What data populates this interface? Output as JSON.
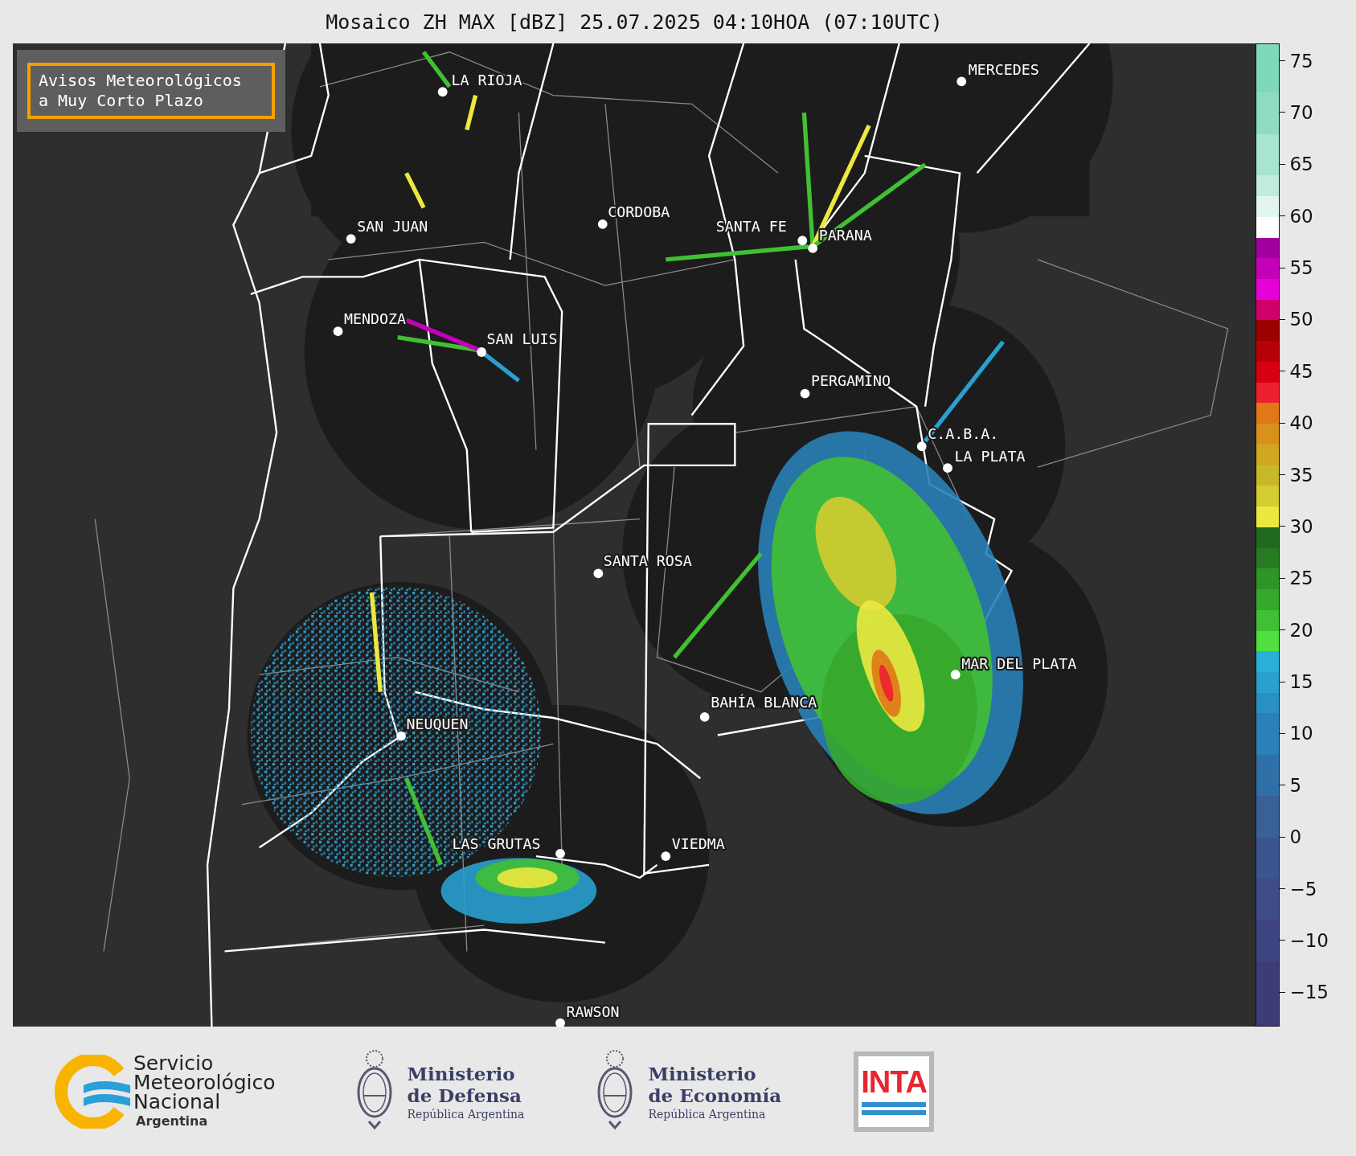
{
  "title": "Mosaico ZH MAX [dBZ] 25.07.2025 04:10HOA (07:10UTC)",
  "notice": {
    "lines": [
      "Avisos Meteorológicos",
      "a Muy Corto Plazo"
    ]
  },
  "cities": [
    {
      "name": "LA RIOJA"
    },
    {
      "name": "SAN JUAN"
    },
    {
      "name": "MENDOZA"
    },
    {
      "name": "SAN LUIS"
    },
    {
      "name": "CORDOBA"
    },
    {
      "name": "SANTA FE"
    },
    {
      "name": "PARANA"
    },
    {
      "name": "MERCEDES"
    },
    {
      "name": "PERGAMINO"
    },
    {
      "name": "C.A.B.A."
    },
    {
      "name": "LA PLATA"
    },
    {
      "name": "SANTA ROSA"
    },
    {
      "name": "MAR DEL PLATA"
    },
    {
      "name": "BAHÍA BLANCA"
    },
    {
      "name": "NEUQUEN"
    },
    {
      "name": "LAS GRUTAS"
    },
    {
      "name": "VIEDMA"
    },
    {
      "name": "RAWSON"
    }
  ],
  "colorbar": {
    "ticks": [
      "75",
      "70",
      "65",
      "60",
      "55",
      "50",
      "45",
      "40",
      "35",
      "30",
      "25",
      "20",
      "15",
      "10",
      "5",
      "0",
      "−5",
      "−10",
      "−15"
    ]
  },
  "footer": {
    "logos": [
      {
        "kind": "smn",
        "lines": [
          "Servicio",
          "Meteorológico",
          "Nacional"
        ],
        "subtitle": "Argentina"
      },
      {
        "kind": "ministry",
        "lines": [
          "Ministerio",
          "de Defensa"
        ],
        "subtitle": "República Argentina"
      },
      {
        "kind": "ministry",
        "lines": [
          "Ministerio",
          "de Economía"
        ],
        "subtitle": "República Argentina"
      },
      {
        "kind": "inta",
        "text": "INTA"
      }
    ]
  }
}
